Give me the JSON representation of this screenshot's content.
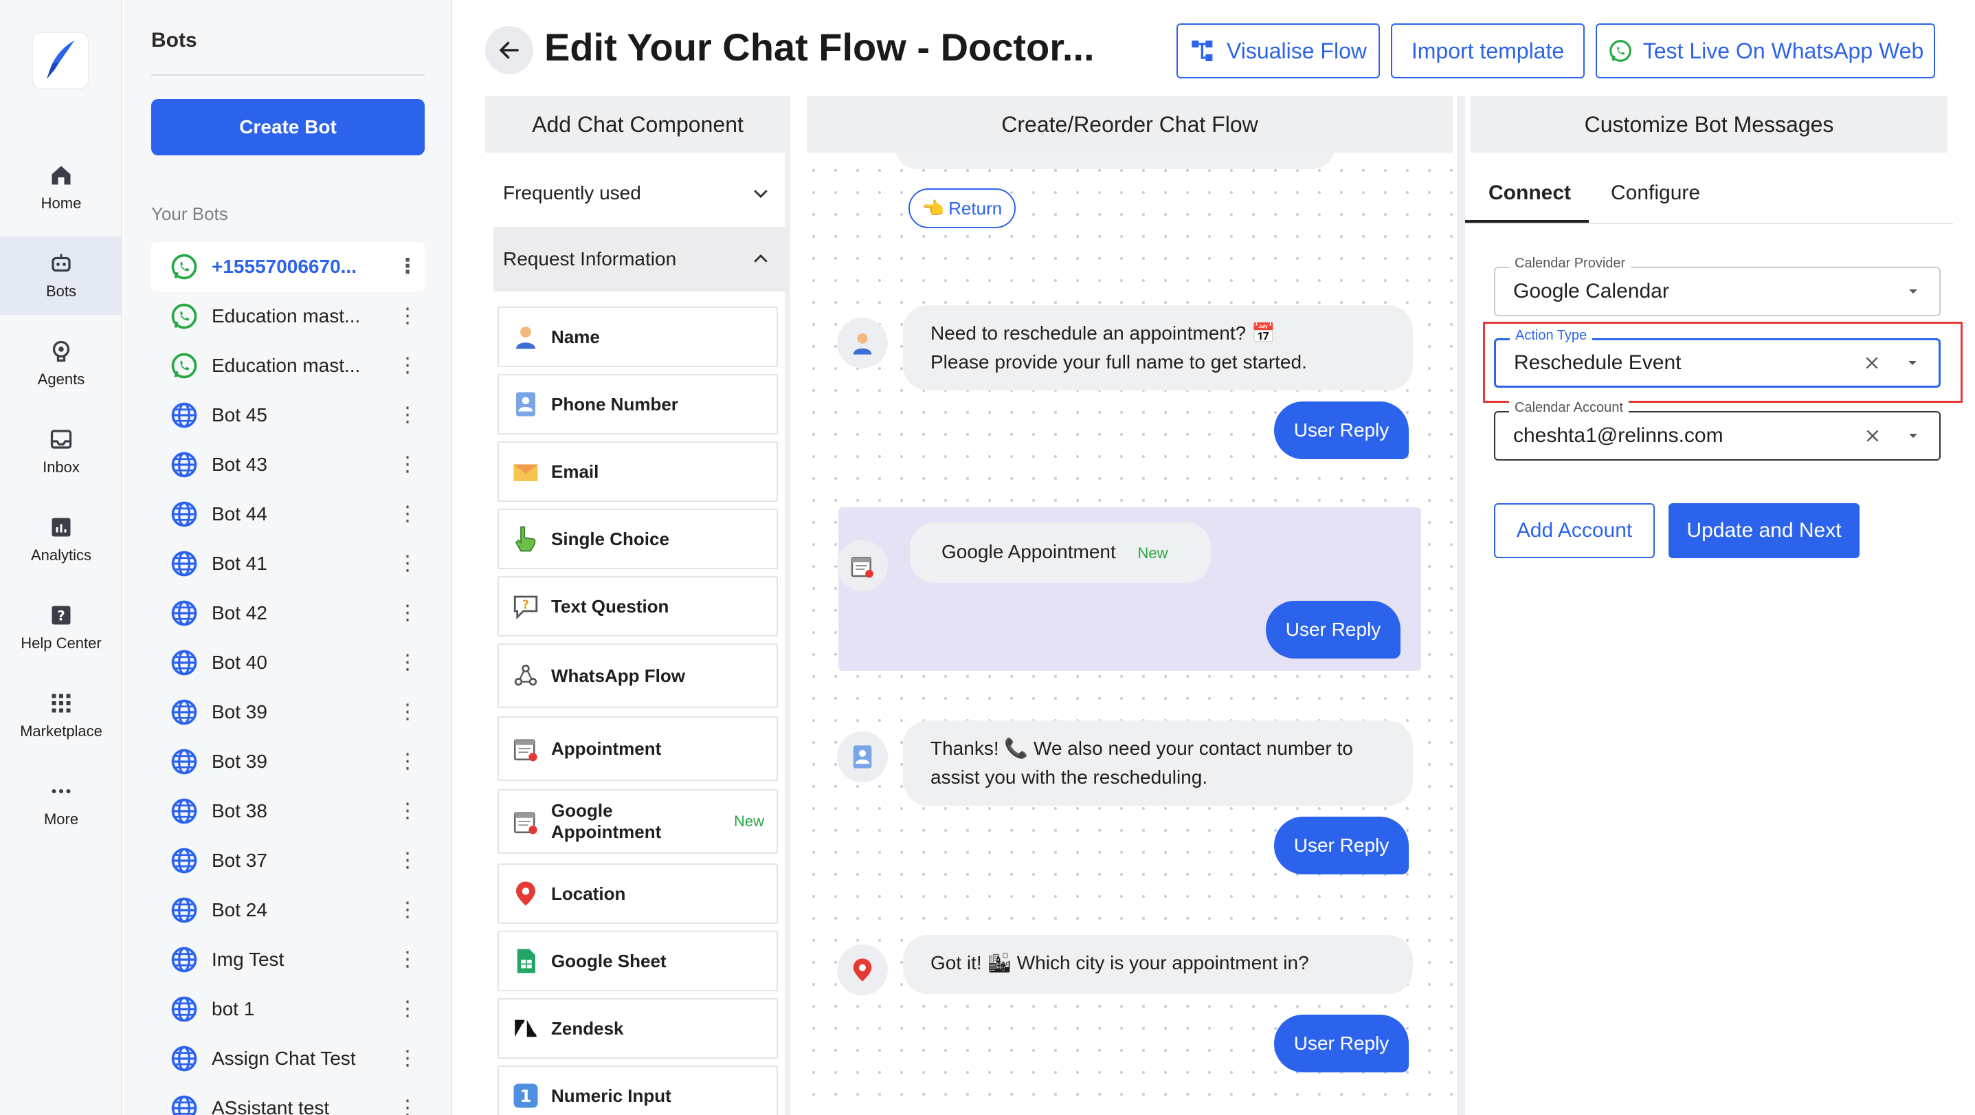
{
  "rail": {
    "items": [
      {
        "label": "Home",
        "icon": "home-icon"
      },
      {
        "label": "Bots",
        "icon": "bot-icon"
      },
      {
        "label": "Agents",
        "icon": "agents-icon"
      },
      {
        "label": "Inbox",
        "icon": "inbox-icon"
      },
      {
        "label": "Analytics",
        "icon": "analytics-icon"
      },
      {
        "label": "Help Center",
        "icon": "help-icon"
      },
      {
        "label": "Marketplace",
        "icon": "marketplace-icon"
      },
      {
        "label": "More",
        "icon": "more-icon"
      }
    ],
    "active": "Bots"
  },
  "bots_panel": {
    "title": "Bots",
    "create_label": "Create Bot",
    "section_label": "Your Bots",
    "bots": [
      {
        "name": "+15557006670...",
        "channel": "whatsapp",
        "active": true
      },
      {
        "name": "Education mast...",
        "channel": "whatsapp"
      },
      {
        "name": "Education mast...",
        "channel": "whatsapp"
      },
      {
        "name": "Bot 45",
        "channel": "web"
      },
      {
        "name": "Bot 43",
        "channel": "web"
      },
      {
        "name": "Bot 44",
        "channel": "web"
      },
      {
        "name": "Bot 41",
        "channel": "web"
      },
      {
        "name": "Bot 42",
        "channel": "web"
      },
      {
        "name": "Bot 40",
        "channel": "web"
      },
      {
        "name": "Bot 39",
        "channel": "web"
      },
      {
        "name": "Bot 39",
        "channel": "web"
      },
      {
        "name": "Bot 38",
        "channel": "web"
      },
      {
        "name": "Bot 37",
        "channel": "web"
      },
      {
        "name": "Bot 24",
        "channel": "web"
      },
      {
        "name": "Img Test",
        "channel": "web"
      },
      {
        "name": "bot 1",
        "channel": "web"
      },
      {
        "name": "Assign Chat Test",
        "channel": "web"
      },
      {
        "name": "ASsistant test",
        "channel": "web"
      }
    ]
  },
  "header": {
    "title": "Edit Your Chat Flow - Doctor...",
    "visualise_label": "Visualise Flow",
    "import_label": "Import template",
    "test_label": "Test Live On WhatsApp Web"
  },
  "columns": {
    "components": "Add Chat Component",
    "flow": "Create/Reorder Chat Flow",
    "customize": "Customize Bot Messages"
  },
  "components": {
    "frequently_used": "Frequently used",
    "request_information": "Request Information",
    "new_tag": "New",
    "items": [
      {
        "label": "Name",
        "icon": "person-icon"
      },
      {
        "label": "Phone Number",
        "icon": "phone-card-icon"
      },
      {
        "label": "Email",
        "icon": "envelope-icon"
      },
      {
        "label": "Single Choice",
        "icon": "pointer-hand-icon"
      },
      {
        "label": "Text Question",
        "icon": "speech-question-icon"
      },
      {
        "label": "WhatsApp Flow",
        "icon": "flow-nodes-icon"
      },
      {
        "label": "Appointment",
        "icon": "calendar-icon"
      },
      {
        "label": "Google Appointment",
        "icon": "calendar-icon",
        "new": true
      },
      {
        "label": "Location",
        "icon": "location-pin-icon"
      },
      {
        "label": "Google Sheet",
        "icon": "sheet-icon"
      },
      {
        "label": "Zendesk",
        "icon": "zendesk-icon"
      },
      {
        "label": "Numeric Input",
        "icon": "number-one-icon"
      }
    ]
  },
  "flow": {
    "return_label": "Return",
    "user_reply_label": "User Reply",
    "messages": [
      {
        "line1": "Need to reschedule an appointment? 📅",
        "line2": "Please provide your full name to get started.",
        "icon": "person-icon"
      },
      {
        "line1": "Google Appointment",
        "tag": "New",
        "icon": "calendar-icon",
        "selected": true
      },
      {
        "line1": "Thanks! 📞 We also need your contact number to",
        "line2": "assist you with the rescheduling.",
        "icon": "phone-card-icon"
      },
      {
        "line1": "Got it! 🏙 Which city is your appointment in?",
        "icon": "location-pin-icon"
      }
    ]
  },
  "customize": {
    "tabs": [
      "Connect",
      "Configure"
    ],
    "active_tab": "Connect",
    "fields": {
      "provider": {
        "label": "Calendar Provider",
        "value": "Google Calendar"
      },
      "action": {
        "label": "Action Type",
        "value": "Reschedule Event"
      },
      "account": {
        "label": "Calendar Account",
        "value": "cheshta1@relinns.com"
      }
    },
    "add_account_label": "Add Account",
    "update_label": "Update and Next"
  },
  "colors": {
    "accent": "#2c63ec",
    "highlight": "#e53935",
    "selected_block": "#e6e2f5",
    "new_tag": "#27a844"
  }
}
